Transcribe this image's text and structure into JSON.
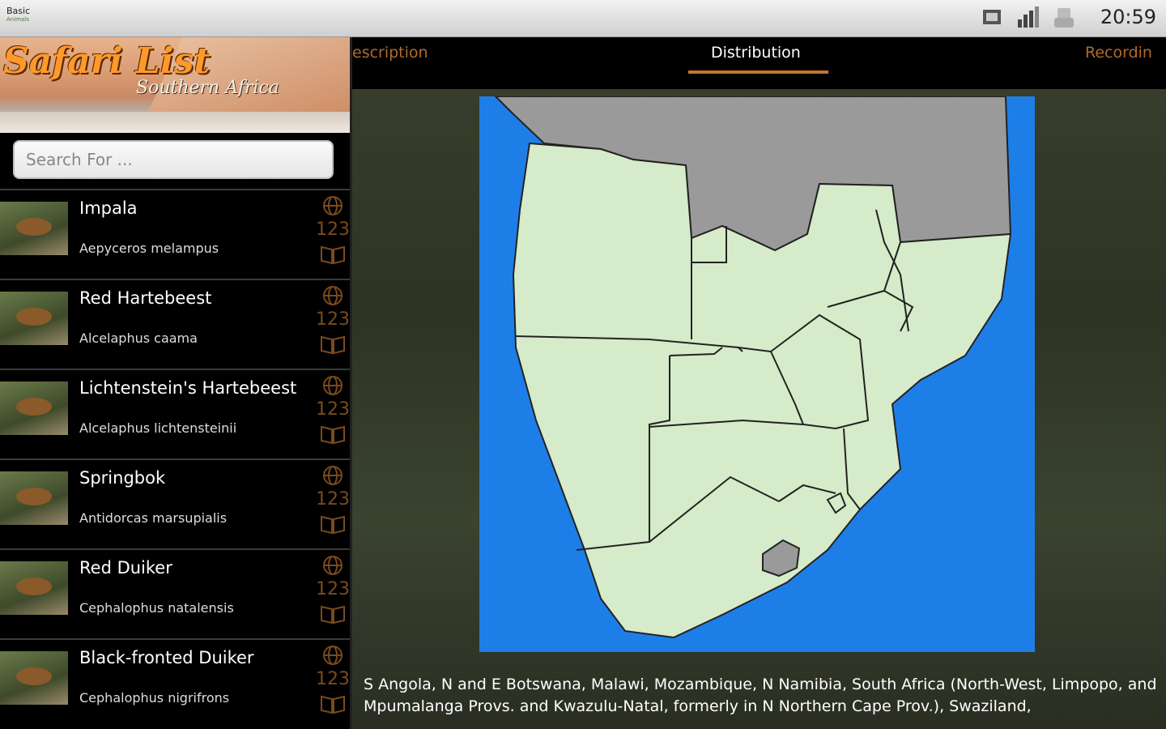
{
  "status_bar": {
    "app_badge": "Basic",
    "app_badge_sub": "Animals",
    "time": "20:59",
    "icons": [
      "screenshot-icon",
      "signal-icon",
      "usb-icon"
    ]
  },
  "banner": {
    "title": "Safari List",
    "subtitle": "Southern Africa"
  },
  "search": {
    "placeholder": "Search For ..."
  },
  "list": [
    {
      "name": "Impala",
      "sci": "Aepyceros melampus",
      "icon_num": "123"
    },
    {
      "name": "Red Hartebeest",
      "sci": "Alcelaphus caama",
      "icon_num": "123"
    },
    {
      "name": "Lichtenstein's Hartebeest",
      "sci": "Alcelaphus lichtensteinii",
      "icon_num": "123"
    },
    {
      "name": "Springbok",
      "sci": "Antidorcas marsupialis",
      "icon_num": "123"
    },
    {
      "name": "Red Duiker",
      "sci": "Cephalophus natalensis",
      "icon_num": "123"
    },
    {
      "name": "Black-fronted Duiker",
      "sci": "Cephalophus nigrifrons",
      "icon_num": "123"
    }
  ],
  "tabs": {
    "description": "escription",
    "distribution": "Distribution",
    "recordings": "Recordin"
  },
  "distribution_text": "S Angola, N and E Botswana, Malawi, Mozambique, N Namibia, South Africa (North-West, Limpopo, and Mpumalanga Provs. and Kwazulu-Natal, formerly in N Northern Cape Prov.), Swaziland,",
  "colors": {
    "accent": "#c5752b",
    "land_range": "#d6ebc9",
    "land_other": "#9a9a9a",
    "sea": "#1e7ee8"
  }
}
